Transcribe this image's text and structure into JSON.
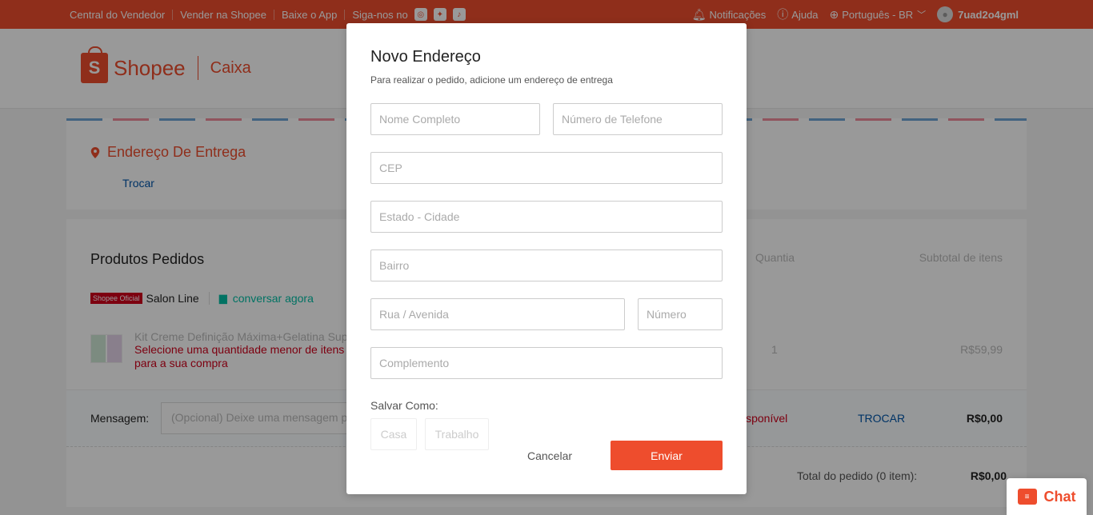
{
  "colors": {
    "brand": "#ee4d2d",
    "link": "#0055aa",
    "error": "#d0011b",
    "chat_green": "#00bfa5"
  },
  "topbar": {
    "links": [
      "Central do Vendedor",
      "Vender na Shopee",
      "Baixe o App",
      "Siga-nos no"
    ],
    "social_icons": [
      "instagram-icon",
      "twitter-icon",
      "tiktok-icon"
    ],
    "notifications": "Notificações",
    "help": "Ajuda",
    "language": "Português - BR",
    "username": "7uad2o4gml"
  },
  "header": {
    "brand": "Shopee",
    "page": "Caixa"
  },
  "address": {
    "title": "Endereço De Entrega",
    "change_link": "Trocar"
  },
  "products": {
    "title": "Produtos Pedidos",
    "col_quantity": "Quantia",
    "col_subtotal": "Subtotal de itens",
    "shop_badge": "Shopee Oficial",
    "shop_name": "Salon Line",
    "chat_now": "conversar agora",
    "item": {
      "name": "Kit Creme Definição Máxima+Gelatina Super",
      "warning": "Selecione uma quantidade menor de itens para a sua compra",
      "quantity": "1",
      "price": "R$59,99"
    },
    "message_label": "Mensagem:",
    "message_placeholder": "(Opcional) Deixe uma mensagem para o vendedor",
    "shipping_unavailable": "isponível",
    "shipping_change": "TROCAR",
    "shipping_price": "R$0,00",
    "total_label": "Total do pedido (0 item):",
    "total_value": "R$0,00"
  },
  "modal": {
    "title": "Novo Endereço",
    "subtitle": "Para realizar o pedido, adicione um endereço de entrega",
    "fields": {
      "name": "Nome Completo",
      "phone": "Número de Telefone",
      "cep": "CEP",
      "state_city": "Estado - Cidade",
      "district": "Bairro",
      "street": "Rua / Avenida",
      "number": "Número",
      "complement": "Complemento"
    },
    "save_as": "Salvar Como:",
    "options": [
      "Casa",
      "Trabalho"
    ],
    "cancel": "Cancelar",
    "submit": "Enviar"
  },
  "chat_widget": {
    "label": "Chat"
  }
}
